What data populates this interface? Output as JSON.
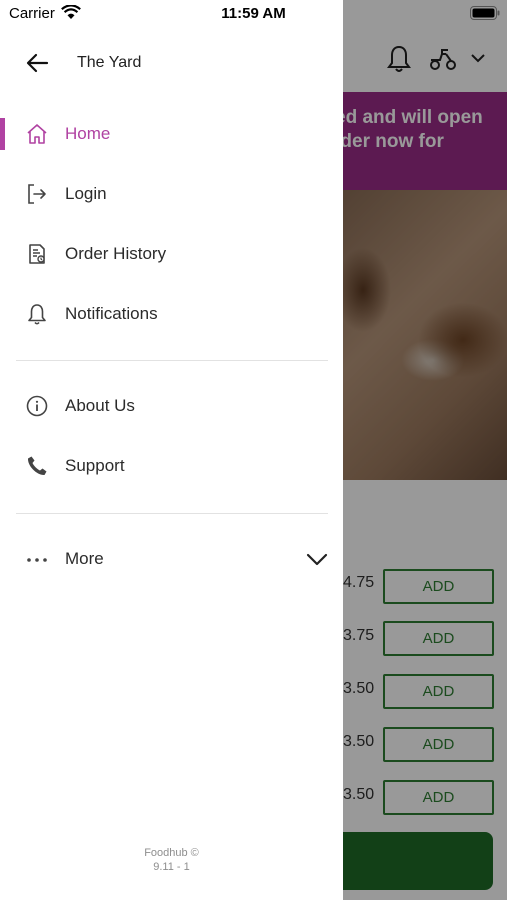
{
  "status_bar": {
    "carrier": "Carrier",
    "time": "11:59 AM"
  },
  "drawer": {
    "restaurant_name": "The Yard",
    "menu_items": [
      {
        "label": "Home",
        "icon": "home-icon",
        "active": true
      },
      {
        "label": "Login",
        "icon": "login-icon",
        "active": false
      },
      {
        "label": "Order History",
        "icon": "order-history-icon",
        "active": false
      },
      {
        "label": "Notifications",
        "icon": "bell-icon",
        "active": false
      }
    ],
    "secondary_items": [
      {
        "label": "About Us",
        "icon": "info-icon"
      },
      {
        "label": "Support",
        "icon": "phone-icon"
      }
    ],
    "more": {
      "label": "More",
      "icon": "more-dots-icon",
      "expand_icon": "chevron-down-icon"
    },
    "footer": {
      "line1": "Foodhub ©",
      "line2": "9.11 - 1"
    }
  },
  "background": {
    "banner_line1": "ed and will open",
    "banner_line2": "rder now for",
    "items": [
      {
        "price": "4.75",
        "action": "ADD"
      },
      {
        "price": "3.75",
        "action": "ADD"
      },
      {
        "price": "3.50",
        "action": "ADD"
      },
      {
        "price": "3.50",
        "action": "ADD"
      },
      {
        "price": "3.50",
        "action": "ADD"
      }
    ]
  },
  "colors": {
    "accent": "#b042a2",
    "banner": "#9a2c88",
    "add_button": "#2e7d32"
  }
}
